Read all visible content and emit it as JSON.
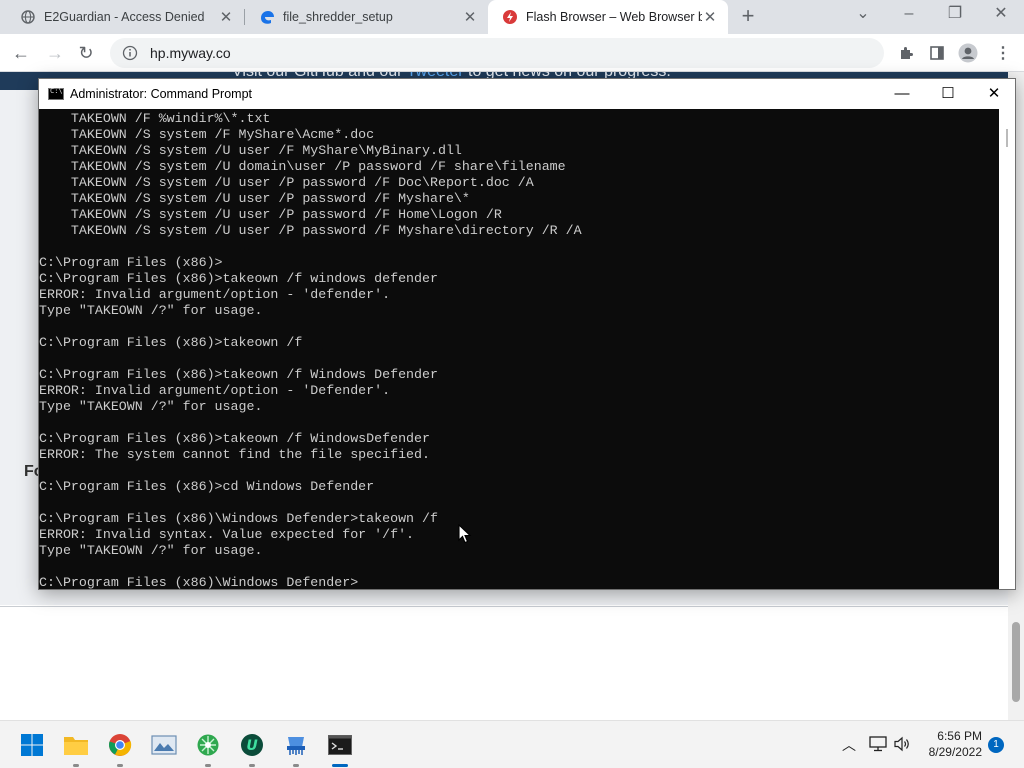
{
  "browser": {
    "tabs": [
      {
        "label": "E2Guardian - Access Denied",
        "icon": "globe-icon"
      },
      {
        "label": "file_shredder_setup",
        "icon": "edge-icon"
      },
      {
        "label": "Flash Browser – Web Browser bu",
        "icon": "flash-icon"
      }
    ],
    "url": "hp.myway.co"
  },
  "page": {
    "banner_before": "Visit our GitHub and our ",
    "banner_link": "Tweeter",
    "banner_after": " to get news on our progress.",
    "fo_text": "Fo"
  },
  "cmd": {
    "title": "Administrator: Command Prompt",
    "lines": [
      "    TAKEOWN /F %windir%\\*.txt",
      "    TAKEOWN /S system /F MyShare\\Acme*.doc",
      "    TAKEOWN /S system /U user /F MyShare\\MyBinary.dll",
      "    TAKEOWN /S system /U domain\\user /P password /F share\\filename",
      "    TAKEOWN /S system /U user /P password /F Doc\\Report.doc /A",
      "    TAKEOWN /S system /U user /P password /F Myshare\\*",
      "    TAKEOWN /S system /U user /P password /F Home\\Logon /R",
      "    TAKEOWN /S system /U user /P password /F Myshare\\directory /R /A",
      "",
      "C:\\Program Files (x86)>",
      "C:\\Program Files (x86)>takeown /f windows defender",
      "ERROR: Invalid argument/option - 'defender'.",
      "Type \"TAKEOWN /?\" for usage.",
      "",
      "C:\\Program Files (x86)>takeown /f",
      "",
      "C:\\Program Files (x86)>takeown /f Windows Defender",
      "ERROR: Invalid argument/option - 'Defender'.",
      "Type \"TAKEOWN /?\" for usage.",
      "",
      "C:\\Program Files (x86)>takeown /f WindowsDefender",
      "ERROR: The system cannot find the file specified.",
      "",
      "C:\\Program Files (x86)>cd Windows Defender",
      "",
      "C:\\Program Files (x86)\\Windows Defender>takeown /f",
      "ERROR: Invalid syntax. Value expected for '/f'.",
      "Type \"TAKEOWN /?\" for usage.",
      "",
      "C:\\Program Files (x86)\\Windows Defender>"
    ]
  },
  "taskbar": {
    "apps": [
      "start-icon",
      "file-explorer-icon",
      "chrome-icon",
      "photos-icon",
      "network-tool-icon",
      "u-app-icon",
      "shredder-icon",
      "command-prompt-icon"
    ],
    "time": "6:56 PM",
    "date": "8/29/2022",
    "notifications": "1"
  },
  "colors": {
    "console_bg": "#0c0c0c",
    "console_text": "#cccccc",
    "accent": "#0067c0"
  }
}
